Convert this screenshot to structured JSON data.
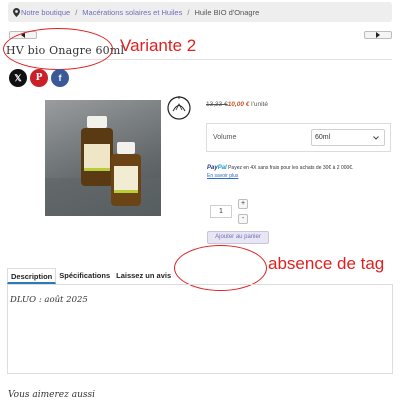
{
  "breadcrumb": {
    "items": [
      {
        "label": "Notre boutique"
      },
      {
        "label": "Macérations solaires et Huiles"
      },
      {
        "label": "Huile BIO d'Onagre"
      }
    ],
    "separator": "/"
  },
  "product": {
    "title": "HV bio Onagre 60ml",
    "price_old": "13,33 €",
    "price_new": "10,00 €",
    "price_unit": " l'unité",
    "variant_label": "Volume",
    "variant_value": "60ml",
    "quantity": "1",
    "qty_plus": "+",
    "qty_minus": "-",
    "add_to_cart": "Ajouter au panier"
  },
  "paypal": {
    "logo_part1": "Pay",
    "logo_part2": "Pal",
    "text": "Payez en 4X sans frais pour les achats de 30€ à 2 000€.",
    "learn_more": "En savoir plus"
  },
  "share": {
    "x": "𝕏",
    "pinterest": "P",
    "facebook": "f"
  },
  "tabs": [
    {
      "label": "Description",
      "active": true
    },
    {
      "label": "Spécifications",
      "active": false
    },
    {
      "label": "Laissez un avis",
      "active": false
    }
  ],
  "description": {
    "dluo": "DLUO : août 2025"
  },
  "annotations": {
    "variante": "Variante 2",
    "absence": "absence de tag",
    "color": "#e02020"
  },
  "sections": {
    "also_like": "Vous aimerez aussi"
  },
  "colors": {
    "link": "#6f6fb8",
    "price_new": "#c7522a",
    "active_tab": "#2a7ab8"
  }
}
